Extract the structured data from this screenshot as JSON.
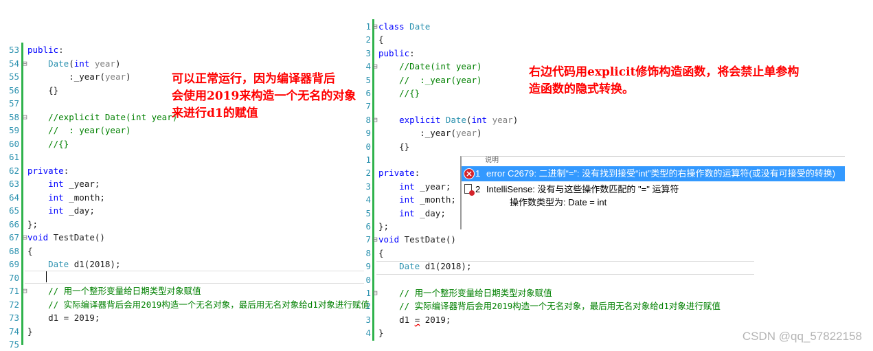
{
  "left_pane": {
    "lines": [
      {
        "n": "53",
        "fold": "",
        "html": "<span class='kw'>public</span>:"
      },
      {
        "n": "54",
        "fold": "⊟",
        "html": "    <span class='ty'>Date</span>(<span class='kw'>int</span> <span class='pa'>year</span>)"
      },
      {
        "n": "55",
        "fold": "",
        "html": "        :_year(<span class='pa'>year</span>)"
      },
      {
        "n": "56",
        "fold": "",
        "html": "    {}"
      },
      {
        "n": "57",
        "fold": "",
        "html": ""
      },
      {
        "n": "58",
        "fold": "⊟",
        "html": "    <span class='cm'>//explicit Date(int year)</span>"
      },
      {
        "n": "59",
        "fold": "",
        "html": "    <span class='cm'>//  : year(year)</span>"
      },
      {
        "n": "60",
        "fold": "",
        "html": "    <span class='cm'>//{}</span>"
      },
      {
        "n": "61",
        "fold": "",
        "html": ""
      },
      {
        "n": "62",
        "fold": "",
        "html": "<span class='kw'>private</span>:"
      },
      {
        "n": "63",
        "fold": "",
        "html": "    <span class='kw'>int</span> _year;"
      },
      {
        "n": "64",
        "fold": "",
        "html": "    <span class='kw'>int</span> _month;"
      },
      {
        "n": "65",
        "fold": "",
        "html": "    <span class='kw'>int</span> _day;"
      },
      {
        "n": "66",
        "fold": "",
        "html": "};"
      },
      {
        "n": "67",
        "fold": "⊟",
        "html": "<span class='kw'>void</span> TestDate()"
      },
      {
        "n": "68",
        "fold": "",
        "html": "{"
      },
      {
        "n": "69",
        "fold": "",
        "html": "    <span class='ty'>Date</span> d1(2018);"
      },
      {
        "n": "70",
        "fold": "",
        "html": ""
      },
      {
        "n": "71",
        "fold": "⊟",
        "html": "    <span class='cm'>// 用一个整形变量给日期类型对象赋值</span>"
      },
      {
        "n": "72",
        "fold": "",
        "html": "    <span class='cm'>// 实际编译器背后会用2019构造一个无名对象，最后用无名对象给d1对象进行赋值</span>"
      },
      {
        "n": "73",
        "fold": "",
        "html": "    d1 = 2019;"
      },
      {
        "n": "74",
        "fold": "",
        "html": "}"
      },
      {
        "n": "75",
        "fold": "",
        "html": ""
      }
    ]
  },
  "right_pane": {
    "lines": [
      {
        "n": "1",
        "fold": "⊟",
        "html": "<span class='kw'>class</span> <span class='ty'>Date</span>"
      },
      {
        "n": "2",
        "fold": "",
        "html": "{"
      },
      {
        "n": "3",
        "fold": "",
        "html": "<span class='kw'>public</span>:"
      },
      {
        "n": "4",
        "fold": "⊟",
        "html": "    <span class='cm'>//Date(int year)</span>"
      },
      {
        "n": "5",
        "fold": "",
        "html": "    <span class='cm'>//  :_year(year)</span>"
      },
      {
        "n": "6",
        "fold": "",
        "html": "    <span class='cm'>//{}</span>"
      },
      {
        "n": "7",
        "fold": "",
        "html": ""
      },
      {
        "n": "8",
        "fold": "⊟",
        "html": "    <span class='kw'>explicit</span> <span class='ty'>Date</span>(<span class='kw'>int</span> <span class='pa'>year</span>)"
      },
      {
        "n": "9",
        "fold": "",
        "html": "        :_year(<span class='pa'>year</span>)"
      },
      {
        "n": "0",
        "fold": "",
        "html": "    {}"
      },
      {
        "n": "1",
        "fold": "",
        "html": ""
      },
      {
        "n": "2",
        "fold": "",
        "html": "<span class='kw'>private</span>:"
      },
      {
        "n": "3",
        "fold": "",
        "html": "    <span class='kw'>int</span> _year;"
      },
      {
        "n": "4",
        "fold": "",
        "html": "    <span class='kw'>int</span> _month;"
      },
      {
        "n": "5",
        "fold": "",
        "html": "    <span class='kw'>int</span> _day;"
      },
      {
        "n": "6",
        "fold": "",
        "html": "};"
      },
      {
        "n": "7",
        "fold": "⊟",
        "html": "<span class='kw'>void</span> TestDate()"
      },
      {
        "n": "8",
        "fold": "",
        "html": "{"
      },
      {
        "n": "9",
        "fold": "",
        "html": "    <span class='ty'>Date</span> d1(2018);"
      },
      {
        "n": "0",
        "fold": "",
        "html": ""
      },
      {
        "n": "1",
        "fold": "⊟",
        "html": "    <span class='cm'>// 用一个整形变量给日期类型对象赋值</span>"
      },
      {
        "n": "2",
        "fold": "",
        "html": "    <span class='cm'>// 实际编译器背后会用2019构造一个无名对象，最后用无名对象给d1对象进行赋值</span>"
      },
      {
        "n": "3",
        "fold": "",
        "html": "    d1 <span class='squiggle'>=</span> 2019;"
      },
      {
        "n": "4",
        "fold": "",
        "html": "}"
      }
    ]
  },
  "annotations": {
    "left": [
      "可以正常运行，因为编译器背后",
      "会使用2019来构造一个无名的对象",
      "来进行d1的赋值"
    ],
    "right": [
      "右边代码用explicit修饰构造函数，将会禁止单参构",
      "造函数的隐式转换。"
    ]
  },
  "error_list": {
    "header": "说明",
    "items": [
      {
        "num": "1",
        "text": "error C2679: 二进制“=”: 没有找到接受“int”类型的右操作数的运算符(或没有可接受的转换)",
        "kind": "error"
      },
      {
        "num": "2",
        "text": "IntelliSense: 没有与这些操作数匹配的 \"=\" 运算符",
        "kind": "intellisense",
        "detail": "操作数类型为:  Date = int"
      }
    ]
  },
  "watermark": "CSDN @qq_57822158",
  "colors": {
    "keyword": "#0000ff",
    "type": "#2b91af",
    "comment": "#008000",
    "annotation": "#ff0000",
    "gutter_bar": "#2fb24c",
    "error_selected": "#3399ff"
  }
}
